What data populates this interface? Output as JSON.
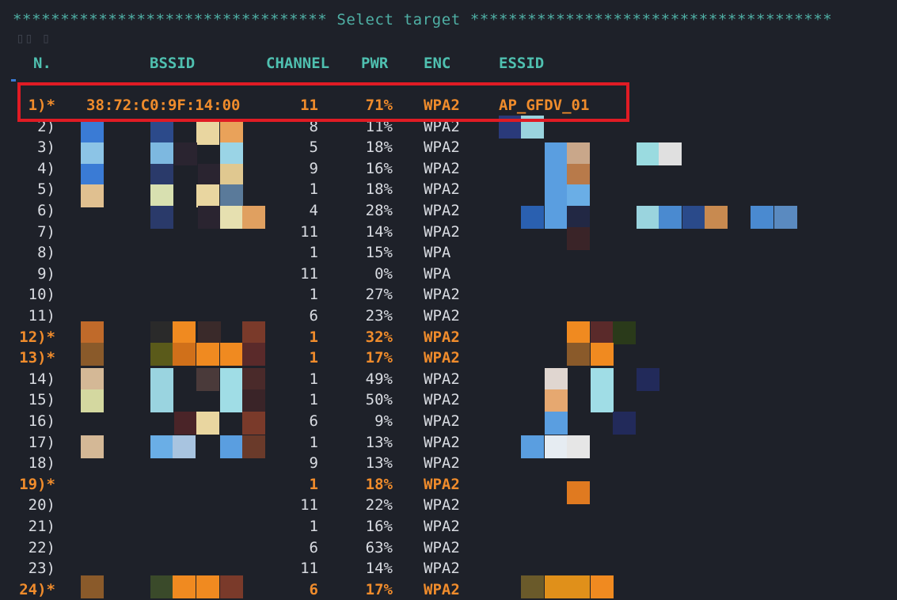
{
  "banner": "********************************* Select target **************************************",
  "headers": {
    "n": "N.",
    "bssid": "BSSID",
    "channel": "CHANNEL",
    "pwr": "PWR",
    "enc": "ENC",
    "essid": "ESSID"
  },
  "rows": [
    {
      "n": "1)*",
      "bssid": "38:72:C0:9F:14:00",
      "ch": "11",
      "pwr": "71%",
      "enc": "WPA2",
      "essid": "AP_GFDV_01",
      "hl": true
    },
    {
      "n": "2)",
      "ch": "8",
      "pwr": "11%",
      "enc": "WPA2"
    },
    {
      "n": "3)",
      "ch": "5",
      "pwr": "18%",
      "enc": "WPA2"
    },
    {
      "n": "4)",
      "ch": "9",
      "pwr": "16%",
      "enc": "WPA2"
    },
    {
      "n": "5)",
      "ch": "1",
      "pwr": "18%",
      "enc": "WPA2"
    },
    {
      "n": "6)",
      "ch": "4",
      "pwr": "28%",
      "enc": "WPA2"
    },
    {
      "n": "7)",
      "ch": "11",
      "pwr": "14%",
      "enc": "WPA2"
    },
    {
      "n": "8)",
      "ch": "1",
      "pwr": "15%",
      "enc": "WPA"
    },
    {
      "n": "9)",
      "ch": "11",
      "pwr": "0%",
      "enc": "WPA"
    },
    {
      "n": "10)",
      "ch": "1",
      "pwr": "27%",
      "enc": "WPA2"
    },
    {
      "n": "11)",
      "ch": "6",
      "pwr": "23%",
      "enc": "WPA2"
    },
    {
      "n": "12)*",
      "ch": "1",
      "pwr": "32%",
      "enc": "WPA2",
      "hl": true
    },
    {
      "n": "13)*",
      "ch": "1",
      "pwr": "17%",
      "enc": "WPA2",
      "hl": true
    },
    {
      "n": "14)",
      "ch": "1",
      "pwr": "49%",
      "enc": "WPA2"
    },
    {
      "n": "15)",
      "ch": "1",
      "pwr": "50%",
      "enc": "WPA2"
    },
    {
      "n": "16)",
      "ch": "6",
      "pwr": "9%",
      "enc": "WPA2"
    },
    {
      "n": "17)",
      "ch": "1",
      "pwr": "13%",
      "enc": "WPA2"
    },
    {
      "n": "18)",
      "ch": "9",
      "pwr": "13%",
      "enc": "WPA2"
    },
    {
      "n": "19)*",
      "ch": "1",
      "pwr": "18%",
      "enc": "WPA2",
      "hl": true
    },
    {
      "n": "20)",
      "ch": "11",
      "pwr": "22%",
      "enc": "WPA2"
    },
    {
      "n": "21)",
      "ch": "1",
      "pwr": "16%",
      "enc": "WPA2"
    },
    {
      "n": "22)",
      "ch": "6",
      "pwr": "63%",
      "enc": "WPA2"
    },
    {
      "n": "23)",
      "ch": "11",
      "pwr": "14%",
      "enc": "WPA2"
    },
    {
      "n": "24)*",
      "ch": "6",
      "pwr": "17%",
      "enc": "WPA2",
      "hl": true
    }
  ],
  "colors": {
    "accent": "#f08c2c",
    "header": "#4fc0b0",
    "banner": "#4fb0a5",
    "highlight_border": "#e01b24",
    "background": "#1e2129"
  }
}
